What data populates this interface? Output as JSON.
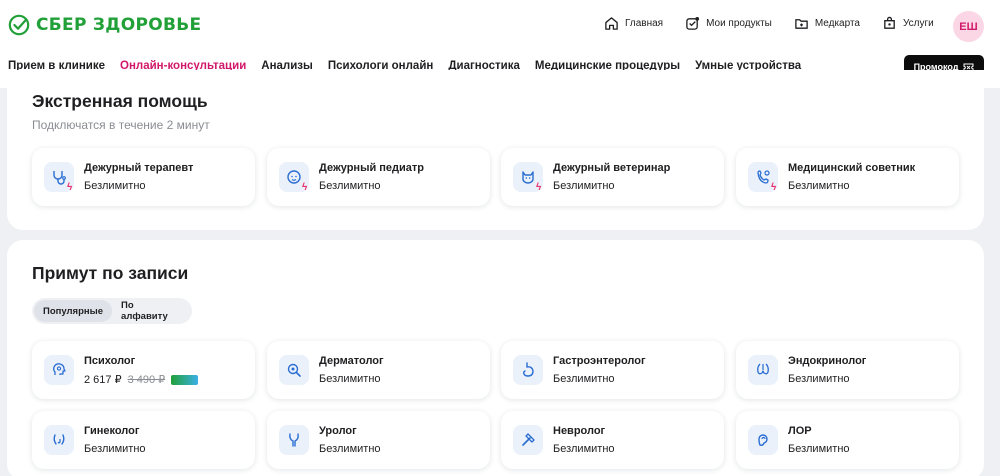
{
  "brand": {
    "name": "СБЕР ЗДОРОВЬЕ",
    "color": "#21a038"
  },
  "topnav": [
    {
      "icon": "home-icon",
      "label": "Главная"
    },
    {
      "icon": "products-icon",
      "label": "Мои продукты"
    },
    {
      "icon": "medcard-icon",
      "label": "Медкарта"
    },
    {
      "icon": "services-icon",
      "label": "Услуги"
    }
  ],
  "user": {
    "initials": "ЕШ"
  },
  "categories": [
    {
      "label": "Прием в клинике",
      "active": false
    },
    {
      "label": "Онлайн-консультации",
      "active": true
    },
    {
      "label": "Анализы",
      "active": false
    },
    {
      "label": "Психологи онлайн",
      "active": false
    },
    {
      "label": "Диагностика",
      "active": false
    },
    {
      "label": "Медицинские процедуры",
      "active": false
    },
    {
      "label": "Умные устройства",
      "active": false
    }
  ],
  "promo_button": "Промокод",
  "emergency": {
    "title": "Экстренная помощь",
    "subtitle": "Подключатся в течение 2 минут",
    "items": [
      {
        "icon": "stethoscope-icon",
        "title": "Дежурный терапевт",
        "sub": "Безлимитно"
      },
      {
        "icon": "baby-icon",
        "title": "Дежурный педиатр",
        "sub": "Безлимитно"
      },
      {
        "icon": "pet-icon",
        "title": "Дежурный ветеринар",
        "sub": "Безлимитно"
      },
      {
        "icon": "advisor-icon",
        "title": "Медицинский советник",
        "sub": "Безлимитно"
      }
    ]
  },
  "scheduled": {
    "title": "Примут по записи",
    "tabs": [
      {
        "label": "Популярные",
        "active": true
      },
      {
        "label": "По алфавиту",
        "active": false
      }
    ],
    "items": [
      {
        "icon": "psychologist-icon",
        "title": "Психолог",
        "price": "2 617 ₽",
        "old_price": "3 490 ₽"
      },
      {
        "icon": "dermatologist-icon",
        "title": "Дерматолог",
        "sub": "Безлимитно"
      },
      {
        "icon": "stomach-icon",
        "title": "Гастроэнтеролог",
        "sub": "Безлимитно"
      },
      {
        "icon": "thyroid-icon",
        "title": "Эндокринолог",
        "sub": "Безлимитно"
      },
      {
        "icon": "gynecologist-icon",
        "title": "Гинеколог",
        "sub": "Безлимитно"
      },
      {
        "icon": "urologist-icon",
        "title": "Уролог",
        "sub": "Безлимитно"
      },
      {
        "icon": "reflex-hammer-icon",
        "title": "Невролог",
        "sub": "Безлимитно"
      },
      {
        "icon": "ear-icon",
        "title": "ЛОР",
        "sub": "Безлимитно"
      }
    ]
  }
}
